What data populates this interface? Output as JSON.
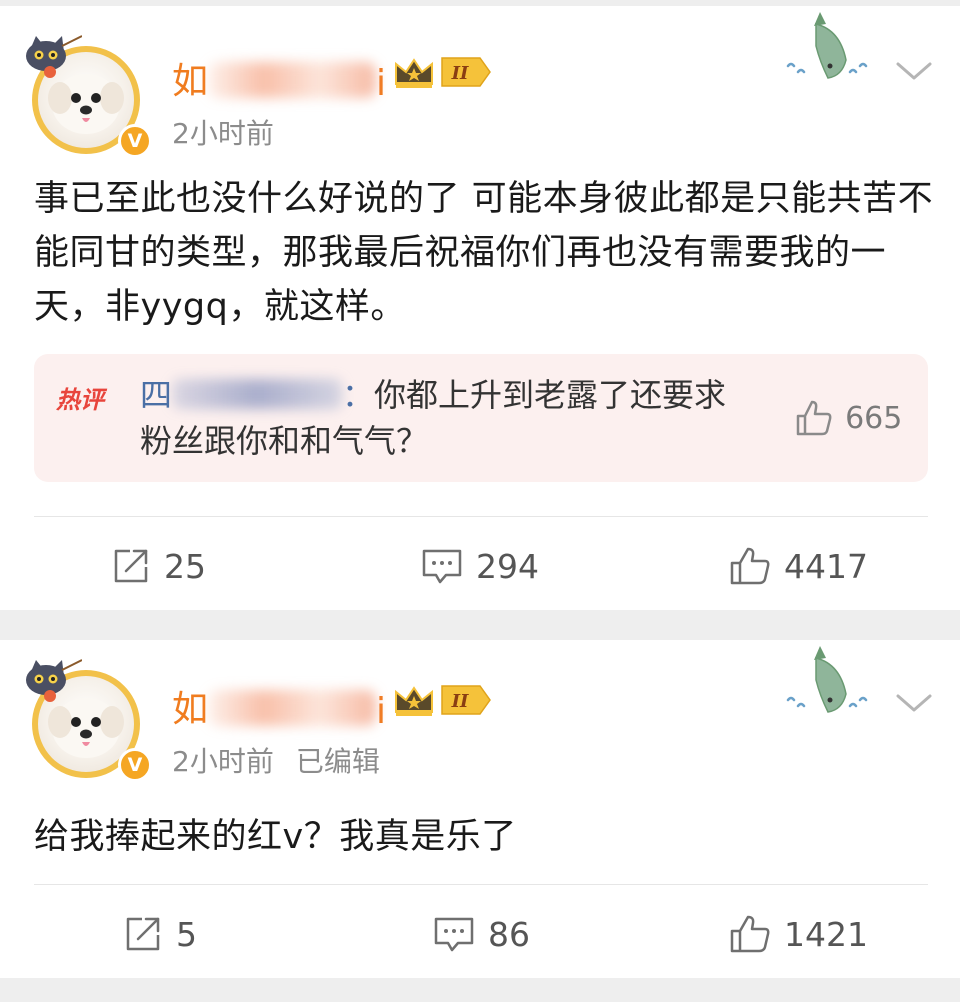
{
  "posts": [
    {
      "author_visible_prefix": "如",
      "author_visible_suffix": "i",
      "vip_level": "II",
      "time": "2小时前",
      "edited": "",
      "content": "事已至此也没什么好说的了 可能本身彼此都是只能共苦不能同甘的类型，那我最后祝福你们再也没有需要我的一天，非yygq，就这样。",
      "hot_comment": {
        "tag": "热评",
        "user_visible_prefix": "四",
        "user_visible_suffix": "：",
        "text": "你都上升到老露了还要求粉丝跟你和和气气？",
        "likes": "665"
      },
      "reposts": "25",
      "comments": "294",
      "likes": "4417"
    },
    {
      "author_visible_prefix": "如",
      "author_visible_suffix": "i",
      "vip_level": "II",
      "time": "2小时前",
      "edited": "已编辑",
      "content": "给我捧起来的红v？我真是乐了",
      "reposts": "5",
      "comments": "86",
      "likes": "1421"
    }
  ],
  "badge": {
    "verified_letter": "V"
  },
  "colors": {
    "username": "#f07c1f",
    "verified_badge": "#f5a623",
    "hot_tag": "#e8453c",
    "hot_bg": "#fcf0ef",
    "hot_user": "#4a6fa5",
    "meta_text": "#8c8c8c"
  },
  "icons": [
    "cat-fishing-avatar-frame",
    "verified-v-icon",
    "vip-crown-icon",
    "fish-decoration-icon",
    "chevron-down-icon",
    "repost-icon",
    "comment-icon",
    "like-icon"
  ]
}
